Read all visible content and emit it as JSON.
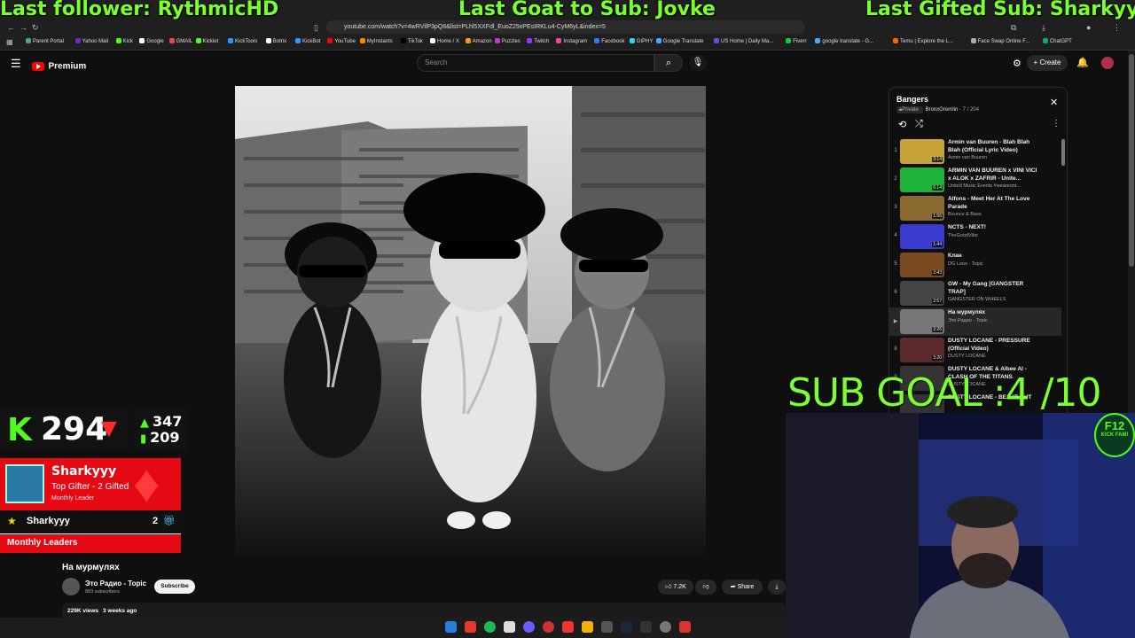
{
  "overlay": {
    "last_follower": "Last follower: RythmicHD",
    "last_goat": "Last Goat to Sub: Jovke",
    "last_gifted": "Last Gifted Sub: Sharkyyy"
  },
  "browser": {
    "url": "youtube.com/watch?v=4wRVilP3pQ8&list=PLhl5XXFdl_EuoZ25xPEsIRKLu4-CyM6yL&index=5",
    "bookmarks": [
      "Parent Portal",
      "Yahoo Mail",
      "Kick",
      "Google",
      "GMAIL",
      "Kicklet",
      "KickTools",
      "Botrix",
      "KickBot",
      "YouTube",
      "MyInstants",
      "TikTok",
      "Home / X",
      "Amazon",
      "Puzzles",
      "Twitch",
      "Instagram",
      "Facebook",
      "GIPHY",
      "Google Translate",
      "US Home | Daily Ma...",
      "Fiverr",
      "google translate - G...",
      "Temu | Explore the L...",
      "Face Swap Online F...",
      "ChatGPT"
    ]
  },
  "youtube": {
    "logo_label": "Premium",
    "search_placeholder": "Search",
    "create_label": "Create"
  },
  "video": {
    "title": "На мурмулях",
    "channel": "Это Радио - Topic",
    "subscribers": "883 subscribers",
    "subscribe_label": "Subscribe",
    "likes": "7.2K",
    "share_label": "Share",
    "views": "229K views",
    "age": "3 weeks ago"
  },
  "playlist": {
    "title": "Bangers",
    "privacy": "Private",
    "owner": "BronxGremlin",
    "position": "- 7 / 204",
    "items": [
      {
        "index": "1",
        "title": "Armin van Buuren - Blah Blah Blah (Official Lyric Video)",
        "channel": "Armin van Buuren",
        "duration": "3:14",
        "thumb_color": "#c8a33a"
      },
      {
        "index": "2",
        "title": "ARMIN VAN BUUREN x VINI VICI x ALOK x ZAFRIR - Unite...",
        "channel": "United Music Events #weareont...",
        "duration": "6:14",
        "thumb_color": "#1db33a"
      },
      {
        "index": "3",
        "title": "Alfons - Meet Her At The Love Parade",
        "channel": "Bounce & Bass",
        "duration": "1:56",
        "thumb_color": "#8a6a30"
      },
      {
        "index": "4",
        "title": "NCTS - NEXT!",
        "channel": "TheGoodVibe",
        "duration": "1:44",
        "thumb_color": "#3a3ad0"
      },
      {
        "index": "5",
        "title": "Клан",
        "channel": "DG Leoo - Topic",
        "duration": "2:43",
        "thumb_color": "#7a4a20"
      },
      {
        "index": "6",
        "title": "GW - My Gang [GANGSTER TRAP]",
        "channel": "GANGSTER ON WHEELS",
        "duration": "2:57",
        "thumb_color": "#444"
      },
      {
        "index": "▶",
        "title": "На мурмулях",
        "channel": "Это Радио - Topic",
        "duration": "2:26",
        "thumb_color": "#777"
      },
      {
        "index": "8",
        "title": "DUSTY LOCANE - PRESSURE (Official Video)",
        "channel": "DUSTY LOCANE",
        "duration": "3:20",
        "thumb_color": "#5a2a2a"
      },
      {
        "index": "9",
        "title": "DUSTY LOCANE & Albee Al - CLASH OF THE TITANS",
        "channel": "DUSTY LOCANE",
        "duration": "",
        "thumb_color": "#333"
      },
      {
        "index": "10",
        "title": "DUSTY LOCANE - BEAST OUT",
        "channel": "",
        "duration": "",
        "thumb_color": "#333"
      }
    ]
  },
  "kick_widget": {
    "logo": "K",
    "viewers": "294",
    "followers_up": "347",
    "followers_total": "209"
  },
  "gifter": {
    "name": "Sharkyyy",
    "subtitle": "Top Gifter - 2 Gifted",
    "label": "Monthly Leader",
    "row_name": "Sharkyyy",
    "row_count": "2",
    "leaders_label": "Monthly Leaders"
  },
  "sub_goal": {
    "text": "SUB GOAL :4  /10",
    "badge_line1": "F12",
    "badge_line2": "KICK FAM!"
  }
}
